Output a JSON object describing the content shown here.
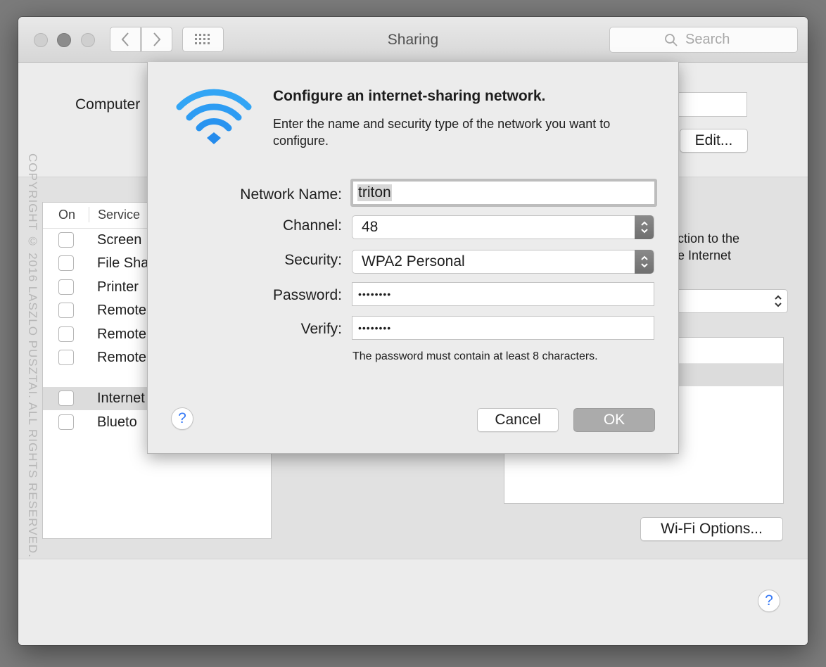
{
  "window": {
    "title": "Sharing",
    "search_placeholder": "Search"
  },
  "main": {
    "computer_label": "Computer",
    "edit_button": "Edit...",
    "services_header": {
      "on": "On",
      "service": "Service"
    },
    "services": [
      {
        "label": "Screen",
        "checked": false,
        "selected": false
      },
      {
        "label": "File Sha",
        "checked": false,
        "selected": false
      },
      {
        "label": "Printer",
        "checked": false,
        "selected": false
      },
      {
        "label": "Remote",
        "checked": false,
        "selected": false
      },
      {
        "label": "Remote",
        "checked": false,
        "selected": false
      },
      {
        "label": "Remote",
        "checked": false,
        "selected": false
      },
      {
        "label": "Internet",
        "checked": false,
        "selected": true
      },
      {
        "label": "Blueto",
        "checked": false,
        "selected": false
      }
    ],
    "right_text_line1": "ction to the",
    "right_text_line2": "e Internet",
    "wifi_options_button": "Wi-Fi Options...",
    "help_label": "?"
  },
  "sheet": {
    "icon": "wifi-icon",
    "title": "Configure an internet-sharing network.",
    "description": "Enter the name and security type of the network you want to configure.",
    "network_name_label": "Network Name:",
    "network_name_value": "triton",
    "channel_label": "Channel:",
    "channel_value": "48",
    "security_label": "Security:",
    "security_value": "WPA2 Personal",
    "password_label": "Password:",
    "password_value": "••••••••",
    "verify_label": "Verify:",
    "verify_value": "••••••••",
    "hint": "The password must contain at least 8 characters.",
    "help_label": "?",
    "cancel_button": "Cancel",
    "ok_button": "OK"
  },
  "watermark": "COPYRIGHT © 2016 LASZLO PUSZTAI. ALL RIGHTS RESERVED.",
  "colors": {
    "accent_blue": "#3478f6",
    "wifi_blue": "#2f9df4",
    "default_button_disabled": "#ababab"
  }
}
